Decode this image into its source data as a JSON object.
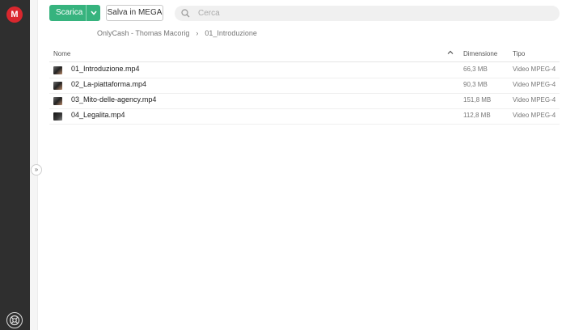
{
  "sidebar": {
    "logo_letter": "M",
    "logo_color": "#d9272e"
  },
  "toolbar": {
    "download_label": "Scarica",
    "save_label": "Salva in MEGA",
    "accent_color": "#36b37e"
  },
  "search": {
    "placeholder": "Cerca"
  },
  "breadcrumb": {
    "items": [
      "OnlyCash - Thomas Macorig",
      "01_Introduzione"
    ],
    "separator": "›"
  },
  "table": {
    "columns": {
      "name": "Nome",
      "size": "Dimensione",
      "type": "Tipo"
    },
    "rows": [
      {
        "name": "01_Introduzione.mp4",
        "size": "66,3 MB",
        "type": "Video MPEG-4"
      },
      {
        "name": "02_La-piattaforma.mp4",
        "size": "90,3 MB",
        "type": "Video MPEG-4"
      },
      {
        "name": "03_Mito-delle-agency.mp4",
        "size": "151,8 MB",
        "type": "Video MPEG-4"
      },
      {
        "name": "04_Legalita.mp4",
        "size": "112,8 MB",
        "type": "Video MPEG-4"
      }
    ]
  },
  "icons": {
    "logo": "mega-logo-icon",
    "search": "search-icon",
    "download_menu": "chevron-down-icon",
    "sort": "chevron-up-icon",
    "expand": "double-chevron-right-icon",
    "help": "lifebuoy-icon"
  }
}
